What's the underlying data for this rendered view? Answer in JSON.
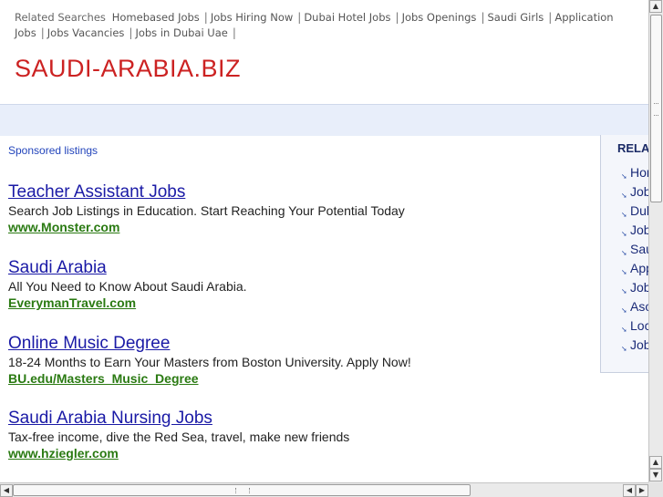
{
  "related_searches": {
    "label": "Related Searches",
    "items": [
      "Homebased Jobs",
      "Jobs Hiring Now",
      "Dubai Hotel Jobs",
      "Jobs Openings",
      "Saudi Girls",
      "Application Jobs",
      "Jobs Vacancies",
      "Jobs in Dubai Uae"
    ],
    "separator": "|"
  },
  "site": {
    "title": "SAUDI-ARABIA.BIZ"
  },
  "sponsored_label": "Sponsored listings",
  "ads": [
    {
      "title": "Teacher Assistant Jobs",
      "description": "Search Job Listings in Education. Start Reaching Your Potential Today",
      "url": "www.Monster.com"
    },
    {
      "title": "Saudi Arabia",
      "description": "All You Need to Know About Saudi Arabia.",
      "url": "EverymanTravel.com"
    },
    {
      "title": "Online Music Degree",
      "description": "18-24 Months to Earn Your Masters from Boston University. Apply Now!",
      "url": "BU.edu/Masters_Music_Degree"
    },
    {
      "title": "Saudi Arabia Nursing Jobs",
      "description": "Tax-free income, dive the Red Sea, travel, make new friends",
      "url": "www.hziegler.com"
    }
  ],
  "sidebar": {
    "heading": "RELAT",
    "items": [
      "Hor",
      "Job",
      "Dul",
      "Job",
      "Sau",
      "App",
      "Job",
      "Aso",
      "Loc",
      "Job"
    ]
  },
  "scrollbars": {
    "up_glyph": "▲",
    "down_glyph": "▼",
    "left_glyph": "◀",
    "right_glyph": "▶"
  },
  "colors": {
    "title_red": "#cc2222",
    "ad_link_blue": "#1a1aa6",
    "ad_url_green": "#2a7a12",
    "banner_blue": "#e8eefa"
  }
}
